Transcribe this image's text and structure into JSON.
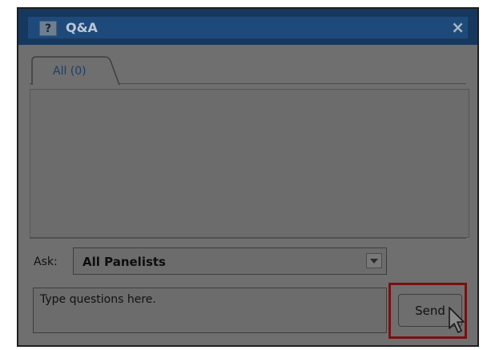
{
  "window": {
    "title": "Q&A",
    "help_icon_glyph": "?",
    "close_icon_glyph": "×"
  },
  "tabs": [
    {
      "label": "All (0)",
      "selected": true
    }
  ],
  "ask": {
    "label": "Ask:",
    "selected_value": "All Panelists"
  },
  "question_input": {
    "placeholder": "Type questions here.",
    "value": ""
  },
  "send_button": {
    "label": "Send"
  },
  "colors": {
    "titlebar": "#1e4a7b",
    "highlight_border": "#7a1010",
    "panel_background": "#6f6f6f"
  }
}
